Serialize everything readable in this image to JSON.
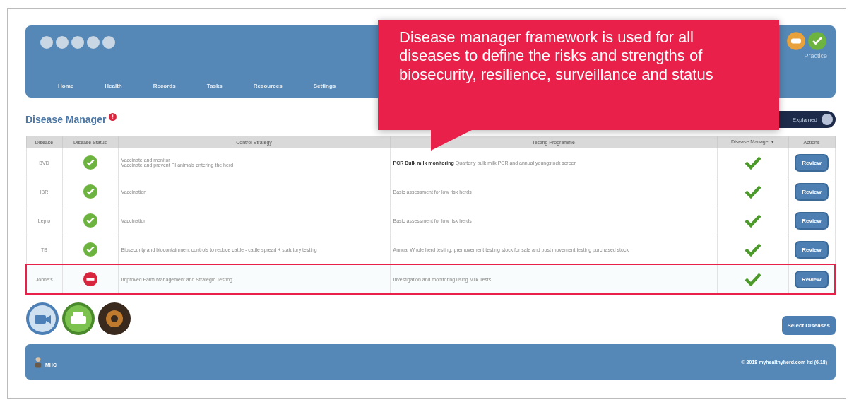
{
  "nav": [
    "Home",
    "Health",
    "Records",
    "Tasks",
    "Resources",
    "Settings"
  ],
  "header_right": {
    "label": "Practice"
  },
  "callout": "Disease manager framework is used for all diseases to define the risks and strengths of biosecurity, resilience, surveillance and status",
  "page_title": "Disease Manager",
  "toggle": {
    "label": "Explained",
    "on": true
  },
  "table": {
    "columns": [
      "Disease",
      "Disease Status",
      "Control Strategy",
      "Testing Programme",
      "Disease Manager ▾",
      "Actions"
    ],
    "rows": [
      {
        "disease": "BVD",
        "kind": "ok",
        "control": [
          "Vaccinate and monitor",
          "Vaccinate and prevent PI animals entering the herd"
        ],
        "testing": "**PCR Bulk milk monitoring** Quarterly bulk milk PCR and annual youngstock screen",
        "managed": true,
        "action": "Review",
        "highlighted": false
      },
      {
        "disease": "IBR",
        "kind": "ok",
        "control": [
          "Vaccination"
        ],
        "testing": "Basic assessment for low risk herds",
        "managed": true,
        "action": "Review",
        "highlighted": false
      },
      {
        "disease": "Lepto",
        "kind": "ok",
        "control": [
          "Vaccination"
        ],
        "testing": "Basic assessment for low risk herds",
        "managed": true,
        "action": "Review",
        "highlighted": false
      },
      {
        "disease": "TB",
        "kind": "ok",
        "control": [
          "Biosecurity and biocontainment controls to reduce cattle - cattle spread + statutory testing"
        ],
        "testing": "Annual Whole herd testing, premovement testing stock for sale and post movement testing purchased stock",
        "managed": true,
        "action": "Review",
        "highlighted": false
      },
      {
        "disease": "Johne's",
        "kind": "alert",
        "control": [
          "Improved Farm Management and Strategic Testing"
        ],
        "testing": "Investigation and monitoring using Milk Tests",
        "managed": true,
        "action": "Review",
        "highlighted": true
      }
    ]
  },
  "select_button": "Select Diseases",
  "footer": {
    "user": "MHC",
    "copyright": "© 2018 myhealthyherd.com ltd (6.18)"
  }
}
